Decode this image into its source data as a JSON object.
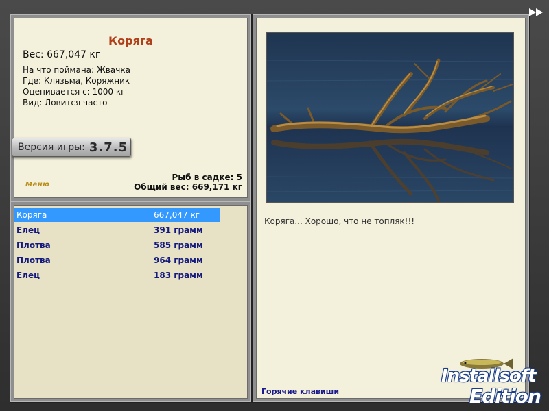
{
  "fish_info": {
    "name": "Коряга",
    "weight_label": "Вес: 667,047 кг",
    "caught_on": "На что поймана: Жвачка",
    "location": "Где: Клязьма, Коряжник",
    "valued_from": "Оценивается с: 1000 кг",
    "frequency": "Вид: Ловится часто"
  },
  "version": {
    "label": "Версия игры:",
    "value": "3.7.5"
  },
  "menu_logo": "Меню",
  "stats": {
    "fish_in_keepnet": "Рыб в садке: 5",
    "total_weight": "Общий вес: 669,171 кг"
  },
  "catch_list": [
    {
      "name": "Коряга",
      "weight": "667,047 кг",
      "selected": true
    },
    {
      "name": "Елец",
      "weight": "391 грамм",
      "selected": false
    },
    {
      "name": "Плотва",
      "weight": "585 грамм",
      "selected": false
    },
    {
      "name": "Плотва",
      "weight": "964 грамм",
      "selected": false
    },
    {
      "name": "Елец",
      "weight": "183 грамм",
      "selected": false
    }
  ],
  "caption": "Коряга... Хорошо, что не топляк!!!",
  "hotkeys_link": "Горячие клавиши",
  "logo": {
    "line1": "Installsoft",
    "line2": "Edition"
  },
  "icons": {
    "fast_forward": "fast-forward-icon"
  },
  "colors": {
    "fish_name": "#b0401a",
    "selected_row": "#3399ff",
    "catch_text": "#141a7e",
    "panel_bg": "#f3f0dc"
  }
}
